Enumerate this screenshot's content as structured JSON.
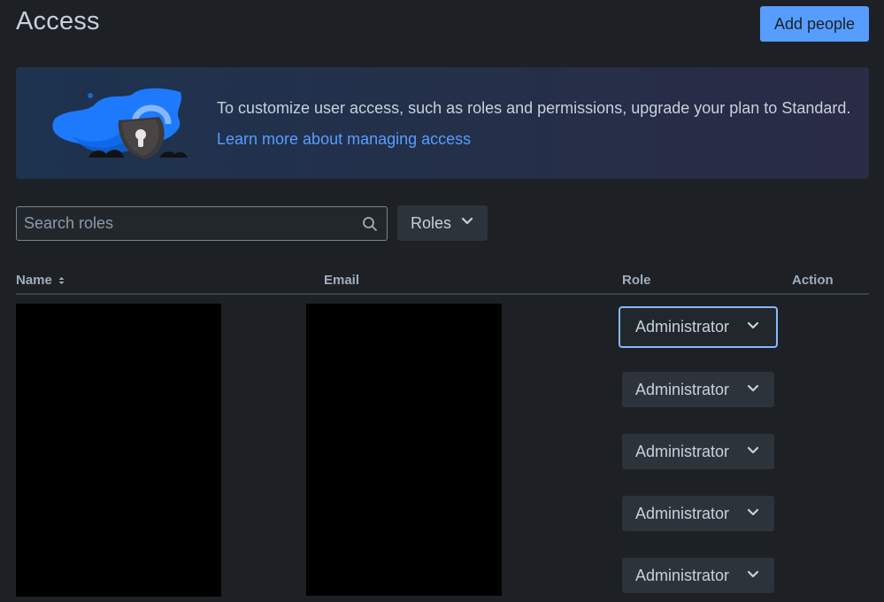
{
  "header": {
    "title": "Access",
    "add_people_label": "Add people"
  },
  "banner": {
    "message": "To customize user access, such as roles and permissions, upgrade your plan to Standard.",
    "link_text": "Learn more about managing access",
    "illustration": "lock-cloud-illustration"
  },
  "filters": {
    "search_placeholder": "Search roles",
    "search_icon": "search-icon",
    "roles_label": "Roles"
  },
  "table": {
    "columns": [
      "Name",
      "Email",
      "Role",
      "Action"
    ],
    "sort_icon": "sort-icon",
    "rows": [
      {
        "name": "",
        "email": "",
        "role": "Administrator",
        "focused": true
      },
      {
        "name": "",
        "email": "",
        "role": "Administrator",
        "focused": false
      },
      {
        "name": "",
        "email": "",
        "role": "Administrator",
        "focused": false
      },
      {
        "name": "",
        "email": "",
        "role": "Administrator",
        "focused": false
      },
      {
        "name": "",
        "email": "",
        "role": "Administrator",
        "focused": false
      }
    ]
  },
  "colors": {
    "background": "#1d2125",
    "primary_button": "#579dff",
    "link": "#579dff",
    "focus_ring": "#85b8ff",
    "redaction": "#000000"
  }
}
